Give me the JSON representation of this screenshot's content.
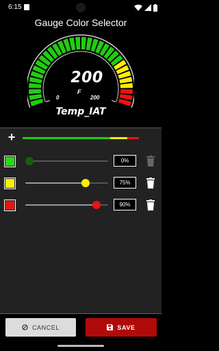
{
  "status_bar": {
    "time": "6:15"
  },
  "app": {
    "title": "Gauge Color Selector"
  },
  "gauge": {
    "value": "200",
    "unit": "F",
    "min_label": "0",
    "max_label": "200",
    "label": "Temp_IAT",
    "colors": [
      "#22cc11",
      "#ffee00",
      "#ee1111"
    ],
    "thresholds": [
      0,
      0.75,
      0.9
    ]
  },
  "color_bar": {
    "segments": [
      {
        "color": "#22cc11",
        "fraction": 0.75
      },
      {
        "color": "#ffee00",
        "fraction": 0.15
      },
      {
        "color": "#ee1111",
        "fraction": 0.1
      }
    ]
  },
  "rows": [
    {
      "color": "#22dd11",
      "thumb_color": "#1a5a12",
      "percent_text": "0%",
      "position": 0.0,
      "trash_active": false
    },
    {
      "color": "#ffee00",
      "thumb_color": "#ffee00",
      "percent_text": "75%",
      "position": 0.75,
      "trash_active": true
    },
    {
      "color": "#ee1111",
      "thumb_color": "#ee1111",
      "percent_text": "90%",
      "position": 0.9,
      "trash_active": true
    }
  ],
  "actions": {
    "cancel_label": "CANCEL",
    "save_label": "SAVE"
  }
}
